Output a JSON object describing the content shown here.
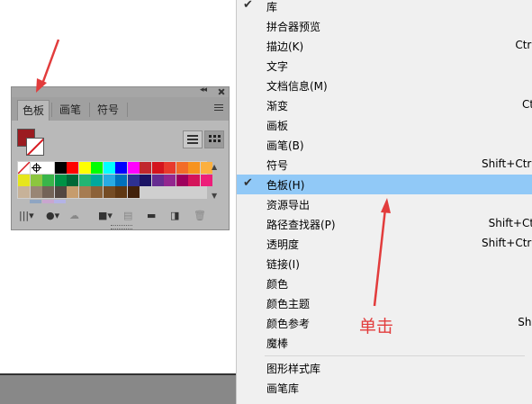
{
  "panel": {
    "tabs": [
      "色板",
      "画笔",
      "符号"
    ],
    "collapse_glyph": "◂◂",
    "fill_color": "#9b1b20",
    "swatch_rows": [
      [
        "none",
        "registration",
        "#ffffff",
        "#000000",
        "#ff0000",
        "#ffff00",
        "#00ff00",
        "#00ffff",
        "#0000ff",
        "#ff00ff",
        "#c1272d",
        "#d4141d",
        "#e8392c",
        "#f26c28",
        "#f7931e",
        "#fbb040"
      ],
      [
        "#e6e61c",
        "#8cc63f",
        "#39b54a",
        "#009245",
        "#006837",
        "#22b573",
        "#00a99d",
        "#29abe2",
        "#0071bc",
        "#2e3192",
        "#1b1464",
        "#662d91",
        "#93278f",
        "#9e005d",
        "#d4145a",
        "#ed1e79"
      ],
      [
        "#c7b299",
        "#998675",
        "#736357",
        "#534741",
        "#c69c6d",
        "#a67c52",
        "#8c6239",
        "#754c24",
        "#603813",
        "#42210b"
      ]
    ],
    "partial_row": [
      "#8fa5c2",
      "#c9a6cf",
      "#b3b3e6"
    ],
    "toolbar_icons": [
      "swatch-library-icon",
      "show-kinds-icon",
      "cloud-library-icon",
      "swatch-options-icon",
      "new-color-group-icon",
      "new-folder-icon",
      "new-swatch-icon",
      "delete-swatch-icon"
    ]
  },
  "menu": {
    "items": [
      {
        "label": "库",
        "shortcut": "",
        "checked": true,
        "highlighted": false
      },
      {
        "label": "拼合器预览",
        "shortcut": "",
        "checked": false,
        "highlighted": false
      },
      {
        "label": "描边(K)",
        "shortcut": "Ctrl-",
        "checked": false,
        "highlighted": false
      },
      {
        "label": "文字",
        "shortcut": "",
        "checked": false,
        "highlighted": false
      },
      {
        "label": "文档信息(M)",
        "shortcut": "",
        "checked": false,
        "highlighted": false
      },
      {
        "label": "渐变",
        "shortcut": "Ctr",
        "checked": false,
        "highlighted": false
      },
      {
        "label": "画板",
        "shortcut": "",
        "checked": false,
        "highlighted": false
      },
      {
        "label": "画笔(B)",
        "shortcut": "",
        "checked": false,
        "highlighted": false
      },
      {
        "label": "符号",
        "shortcut": "Shift+Ctrl-",
        "checked": false,
        "highlighted": false
      },
      {
        "label": "色板(H)",
        "shortcut": "",
        "checked": true,
        "highlighted": true
      },
      {
        "label": "资源导出",
        "shortcut": "",
        "checked": false,
        "highlighted": false
      },
      {
        "label": "路径查找器(P)",
        "shortcut": "Shift+Ctr",
        "checked": false,
        "highlighted": false
      },
      {
        "label": "透明度",
        "shortcut": "Shift+Ctrl-",
        "checked": false,
        "highlighted": false
      },
      {
        "label": "链接(I)",
        "shortcut": "",
        "checked": false,
        "highlighted": false
      },
      {
        "label": "颜色",
        "shortcut": "",
        "checked": false,
        "highlighted": false
      },
      {
        "label": "颜色主题",
        "shortcut": "",
        "checked": false,
        "highlighted": false
      },
      {
        "label": "颜色参考",
        "shortcut": "Shif",
        "checked": false,
        "highlighted": false
      },
      {
        "label": "魔棒",
        "shortcut": "",
        "checked": false,
        "highlighted": false
      },
      {
        "label": "图形样式库",
        "shortcut": "",
        "checked": false,
        "highlighted": false
      },
      {
        "label": "画笔库",
        "shortcut": "",
        "checked": false,
        "highlighted": false
      }
    ],
    "highlight_color": "#91c9f7"
  },
  "annotation": {
    "text": "单击",
    "color": "#e23c3c"
  }
}
